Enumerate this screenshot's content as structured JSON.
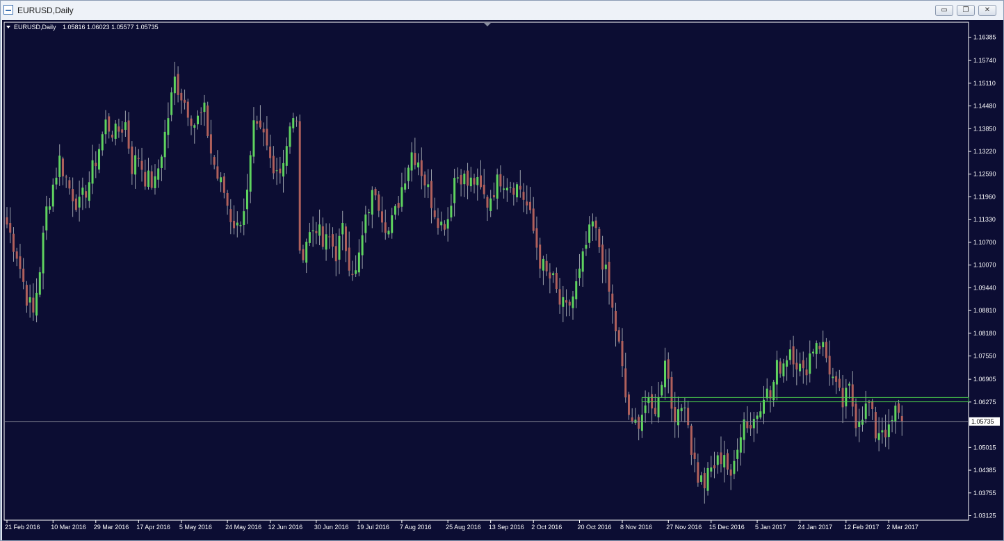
{
  "window": {
    "title": "EURUSD,Daily",
    "minimize_label": "▭",
    "restore_label": "❐",
    "close_label": "✕"
  },
  "chart_data": {
    "type": "candlestick",
    "header": {
      "symbol_label": "EURUSD,Daily",
      "ohlc_text": "1.05816 1.06023 1.05577 1.05735"
    },
    "ylim": [
      1.03,
      1.168
    ],
    "y_ticks": [
      "1.16385",
      "1.15740",
      "1.15110",
      "1.14480",
      "1.13850",
      "1.13220",
      "1.12590",
      "1.11960",
      "1.11330",
      "1.10700",
      "1.10070",
      "1.09440",
      "1.08810",
      "1.08180",
      "1.07550",
      "1.06905",
      "1.06275",
      "1.05015",
      "1.04385",
      "1.03755",
      "1.03125"
    ],
    "current_price": 1.05735,
    "current_price_label": "1.05735",
    "x_ticks": [
      {
        "label": "21 Feb 2016",
        "bar": 0
      },
      {
        "label": "10 Mar 2016",
        "bar": 14
      },
      {
        "label": "29 Mar 2016",
        "bar": 27
      },
      {
        "label": "17 Apr 2016",
        "bar": 40
      },
      {
        "label": "5 May 2016",
        "bar": 53
      },
      {
        "label": "24 May 2016",
        "bar": 67
      },
      {
        "label": "12 Jun 2016",
        "bar": 80
      },
      {
        "label": "30 Jun 2016",
        "bar": 94
      },
      {
        "label": "19 Jul 2016",
        "bar": 107
      },
      {
        "label": "7 Aug 2016",
        "bar": 120
      },
      {
        "label": "25 Aug 2016",
        "bar": 134
      },
      {
        "label": "13 Sep 2016",
        "bar": 147
      },
      {
        "label": "2 Oct 2016",
        "bar": 160
      },
      {
        "label": "20 Oct 2016",
        "bar": 174
      },
      {
        "label": "8 Nov 2016",
        "bar": 187
      },
      {
        "label": "27 Nov 2016",
        "bar": 201
      },
      {
        "label": "15 Dec 2016",
        "bar": 214
      },
      {
        "label": "5 Jan 2017",
        "bar": 228
      },
      {
        "label": "24 Jan 2017",
        "bar": 241
      },
      {
        "label": "12 Feb 2017",
        "bar": 255
      },
      {
        "label": "2 Mar 2017",
        "bar": 268
      }
    ],
    "bar_count": 273,
    "close_anchors": [
      [
        0,
        1.112
      ],
      [
        3,
        1.104
      ],
      [
        6,
        1.092
      ],
      [
        8,
        1.087
      ],
      [
        10,
        1.1
      ],
      [
        12,
        1.116
      ],
      [
        16,
        1.13
      ],
      [
        19,
        1.122
      ],
      [
        22,
        1.117
      ],
      [
        25,
        1.124
      ],
      [
        27,
        1.13
      ],
      [
        30,
        1.14
      ],
      [
        33,
        1.137
      ],
      [
        36,
        1.14
      ],
      [
        38,
        1.128
      ],
      [
        40,
        1.131
      ],
      [
        42,
        1.125
      ],
      [
        45,
        1.123
      ],
      [
        48,
        1.137
      ],
      [
        51,
        1.152
      ],
      [
        53,
        1.148
      ],
      [
        55,
        1.144
      ],
      [
        57,
        1.14
      ],
      [
        60,
        1.143
      ],
      [
        62,
        1.132
      ],
      [
        64,
        1.125
      ],
      [
        66,
        1.121
      ],
      [
        68,
        1.114
      ],
      [
        70,
        1.111
      ],
      [
        73,
        1.12
      ],
      [
        75,
        1.138
      ],
      [
        78,
        1.136
      ],
      [
        80,
        1.13
      ],
      [
        83,
        1.127
      ],
      [
        86,
        1.138
      ],
      [
        88,
        1.142
      ],
      [
        89,
        1.102
      ],
      [
        91,
        1.108
      ],
      [
        94,
        1.112
      ],
      [
        96,
        1.106
      ],
      [
        98,
        1.108
      ],
      [
        100,
        1.104
      ],
      [
        102,
        1.11
      ],
      [
        104,
        1.102
      ],
      [
        106,
        1.098
      ],
      [
        108,
        1.108
      ],
      [
        110,
        1.117
      ],
      [
        112,
        1.122
      ],
      [
        114,
        1.115
      ],
      [
        116,
        1.11
      ],
      [
        118,
        1.115
      ],
      [
        121,
        1.126
      ],
      [
        123,
        1.132
      ],
      [
        125,
        1.13
      ],
      [
        127,
        1.124
      ],
      [
        130,
        1.116
      ],
      [
        132,
        1.112
      ],
      [
        134,
        1.114
      ],
      [
        136,
        1.125
      ],
      [
        138,
        1.126
      ],
      [
        140,
        1.123
      ],
      [
        142,
        1.124
      ],
      [
        144,
        1.121
      ],
      [
        146,
        1.118
      ],
      [
        148,
        1.122
      ],
      [
        150,
        1.125
      ],
      [
        152,
        1.124
      ],
      [
        154,
        1.123
      ],
      [
        156,
        1.122
      ],
      [
        158,
        1.117
      ],
      [
        160,
        1.11
      ],
      [
        162,
        1.102
      ],
      [
        164,
        1.098
      ],
      [
        166,
        1.096
      ],
      [
        168,
        1.09
      ],
      [
        170,
        1.088
      ],
      [
        172,
        1.092
      ],
      [
        174,
        1.098
      ],
      [
        176,
        1.106
      ],
      [
        178,
        1.112
      ],
      [
        180,
        1.106
      ],
      [
        182,
        1.098
      ],
      [
        184,
        1.088
      ],
      [
        186,
        1.078
      ],
      [
        188,
        1.064
      ],
      [
        190,
        1.055
      ],
      [
        192,
        1.058
      ],
      [
        194,
        1.062
      ],
      [
        196,
        1.06
      ],
      [
        198,
        1.063
      ],
      [
        200,
        1.076
      ],
      [
        202,
        1.062
      ],
      [
        204,
        1.058
      ],
      [
        206,
        1.064
      ],
      [
        208,
        1.05
      ],
      [
        210,
        1.042
      ],
      [
        212,
        1.04
      ],
      [
        214,
        1.044
      ],
      [
        216,
        1.046
      ],
      [
        218,
        1.049
      ],
      [
        220,
        1.04
      ],
      [
        222,
        1.052
      ],
      [
        224,
        1.058
      ],
      [
        226,
        1.056
      ],
      [
        228,
        1.06
      ],
      [
        230,
        1.066
      ],
      [
        232,
        1.064
      ],
      [
        234,
        1.072
      ],
      [
        236,
        1.074
      ],
      [
        238,
        1.078
      ],
      [
        240,
        1.074
      ],
      [
        242,
        1.07
      ],
      [
        244,
        1.076
      ],
      [
        246,
        1.08
      ],
      [
        248,
        1.078
      ],
      [
        250,
        1.072
      ],
      [
        252,
        1.066
      ],
      [
        254,
        1.062
      ],
      [
        256,
        1.066
      ],
      [
        258,
        1.058
      ],
      [
        260,
        1.06
      ],
      [
        262,
        1.062
      ],
      [
        264,
        1.054
      ],
      [
        266,
        1.056
      ],
      [
        268,
        1.054
      ],
      [
        270,
        1.06
      ],
      [
        272,
        1.057
      ]
    ],
    "support_zone": {
      "start_bar": 193,
      "upper": 1.064,
      "lower": 1.0628
    },
    "colors": {
      "background": "#0c0d33",
      "bull": "#5fd35f",
      "bear": "#b0605c",
      "wick": "#9aa0aa",
      "grid_frame": "#ffffff",
      "zone": "#4ccf4c",
      "price_line": "#8a8c99"
    }
  }
}
